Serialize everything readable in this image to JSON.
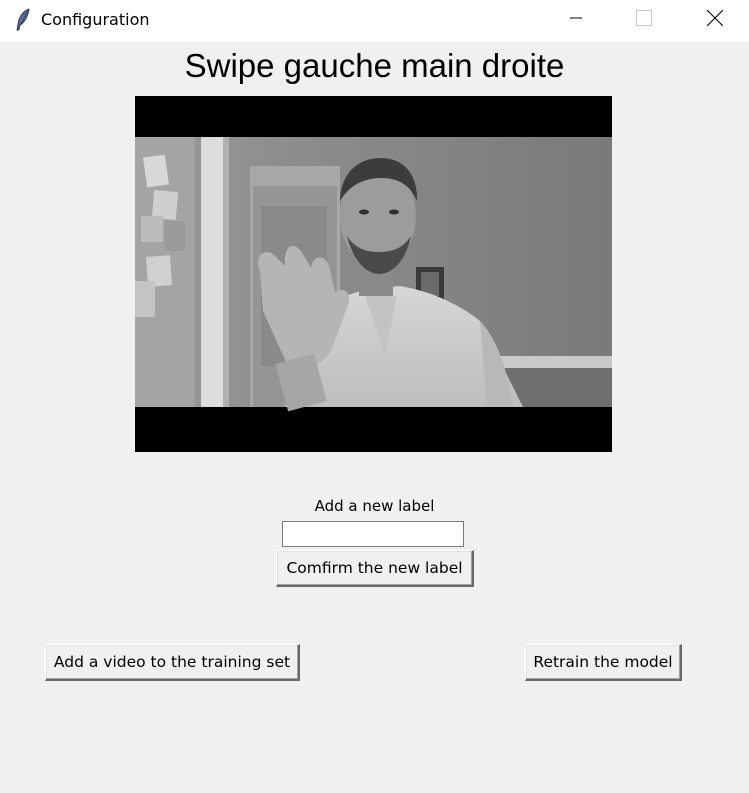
{
  "window": {
    "title": "Configuration",
    "icon": "feather-icon",
    "controls": [
      "minimize-icon",
      "maximize-icon",
      "close-icon"
    ]
  },
  "main": {
    "heading": "Swipe gauche main droite",
    "video": {
      "description_icon": "webcam-frame",
      "mode": "grayscale"
    },
    "new_label": {
      "label": "Add a new label",
      "input_value": "",
      "confirm_button": "Comfirm the new label"
    },
    "actions": {
      "add_video_button": "Add a video to the training set",
      "retrain_button": "Retrain the model"
    }
  },
  "colors": {
    "window_bg": "#f0f0f0",
    "titlebar_bg": "#ffffff",
    "video_letterbox": "#000000"
  }
}
